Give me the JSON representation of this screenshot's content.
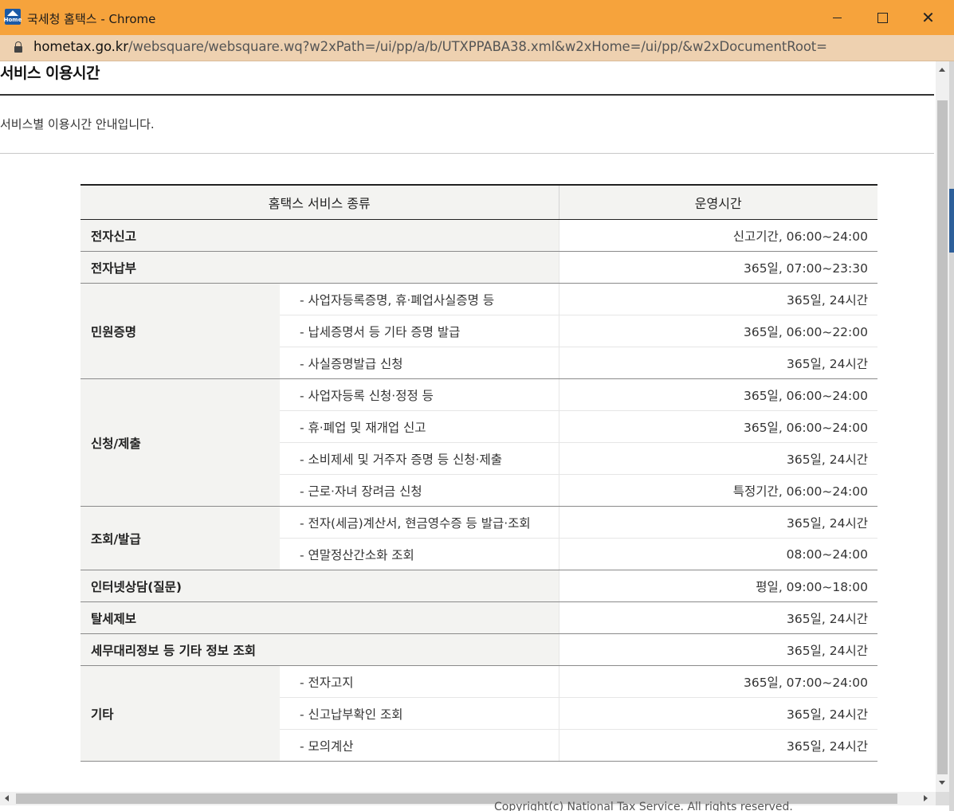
{
  "window": {
    "title": "국세청 홈택스 - Chrome",
    "app_icon": "hometax-house-icon",
    "app_icon_text": "Home"
  },
  "address": {
    "host": "hometax.go.kr",
    "path": "/websquare/websquare.wq?w2xPath=/ui/pp/a/b/UTXPPABA38.xml&w2xHome=/ui/pp/&w2xDocumentRoot="
  },
  "page": {
    "title": "서비스 이용시간",
    "description": "서비스별 이용시간 안내입니다."
  },
  "table": {
    "headers": [
      "홈택스 서비스 종류",
      "운영시간"
    ],
    "rows": [
      {
        "category": "전자신고",
        "time": "신고기간, 06:00~24:00"
      },
      {
        "category": "전자납부",
        "time": "365일, 07:00~23:30"
      },
      {
        "category": "민원증명",
        "items": [
          {
            "label": "- 사업자등록증명, 휴·폐업사실증명 등",
            "time": "365일, 24시간"
          },
          {
            "label": "- 납세증명서 등 기타 증명 발급",
            "time": "365일, 06:00~22:00"
          },
          {
            "label": "- 사실증명발급 신청",
            "time": "365일, 24시간"
          }
        ]
      },
      {
        "category": "신청/제출",
        "items": [
          {
            "label": "- 사업자등록 신청·정정 등",
            "time": "365일, 06:00~24:00"
          },
          {
            "label": "- 휴·폐업 및 재개업 신고",
            "time": "365일, 06:00~24:00"
          },
          {
            "label": "- 소비제세 및 거주자 증명 등 신청·제출",
            "time": "365일, 24시간"
          },
          {
            "label": "- 근로·자녀 장려금 신청",
            "time": "특정기간, 06:00~24:00"
          }
        ]
      },
      {
        "category": "조회/발급",
        "items": [
          {
            "label": "- 전자(세금)계산서, 현금영수증 등 발급·조회",
            "time": "365일, 24시간"
          },
          {
            "label": "- 연말정산간소화 조회",
            "time": "08:00~24:00"
          }
        ]
      },
      {
        "category": "인터넷상담(질문)",
        "time": "평일, 09:00~18:00"
      },
      {
        "category": "탈세제보",
        "time": "365일, 24시간"
      },
      {
        "category": "세무대리정보 등 기타 정보 조회",
        "time": "365일, 24시간"
      },
      {
        "category": "기타",
        "items": [
          {
            "label": "- 전자고지",
            "time": "365일, 07:00~24:00"
          },
          {
            "label": "- 신고납부확인 조회",
            "time": "365일, 24시간"
          },
          {
            "label": "- 모의계산",
            "time": "365일, 24시간"
          }
        ]
      }
    ]
  },
  "footer_peek": "Copyright(c) National Tax Service. All rights reserved.",
  "colors": {
    "titlebar": "#f6a33c",
    "addressbar": "#eed1b0",
    "category_bg": "#f3f3f1"
  }
}
